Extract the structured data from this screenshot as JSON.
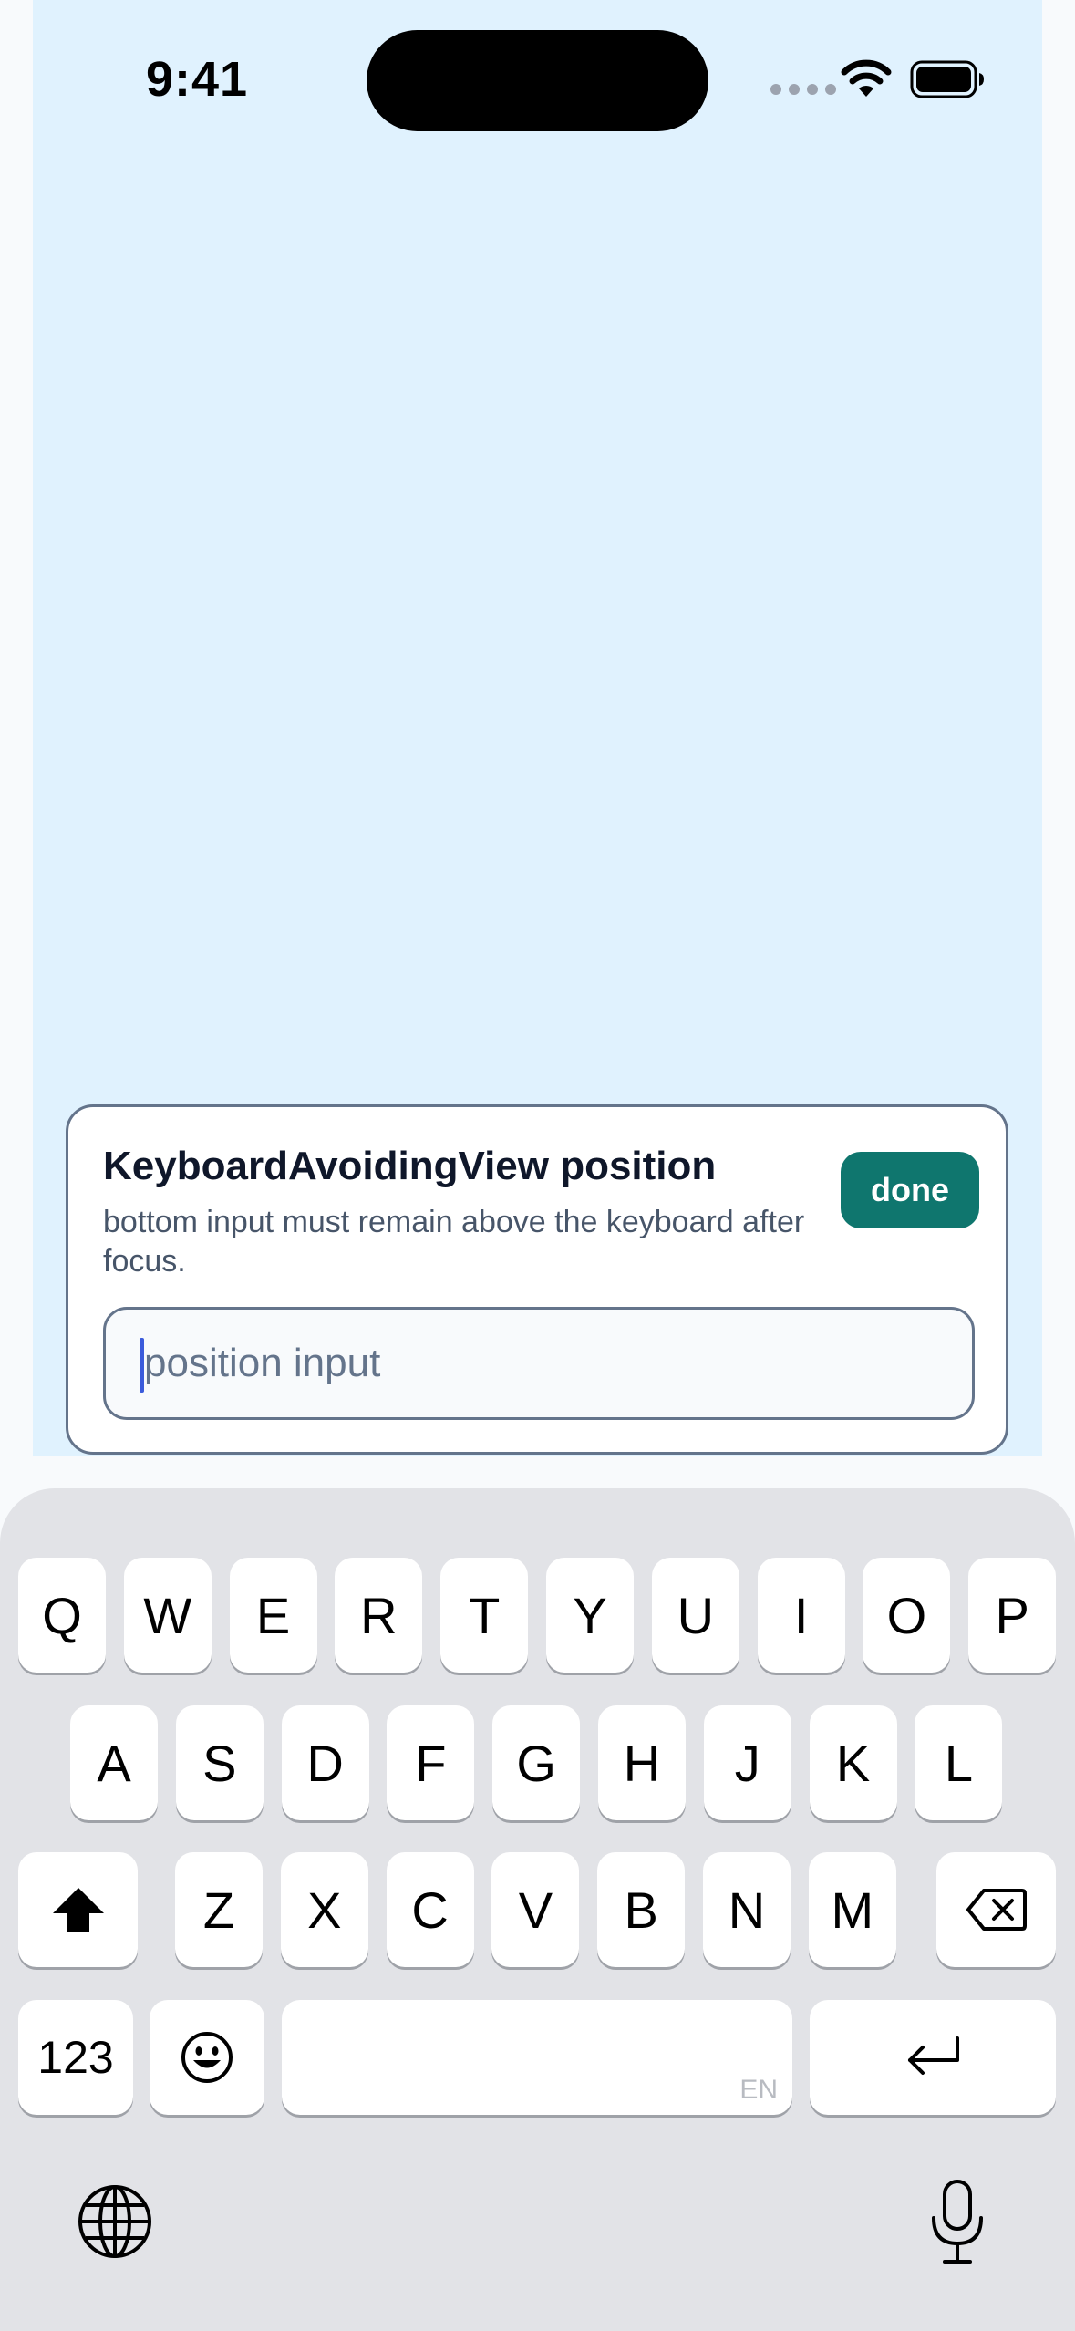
{
  "status_bar": {
    "time": "9:41"
  },
  "card": {
    "title": "KeyboardAvoidingView position",
    "description": "bottom input must remain above the keyboard after focus.",
    "done_label": "done",
    "input_placeholder": "position input"
  },
  "keyboard": {
    "row1": [
      "Q",
      "W",
      "E",
      "R",
      "T",
      "Y",
      "U",
      "I",
      "O",
      "P"
    ],
    "row2": [
      "A",
      "S",
      "D",
      "F",
      "G",
      "H",
      "J",
      "K",
      "L"
    ],
    "row3": [
      "Z",
      "X",
      "C",
      "V",
      "B",
      "N",
      "M"
    ],
    "numbers_label": "123",
    "space_hint": "EN"
  },
  "colors": {
    "app_background": "#e0f2fe",
    "accent": "#0f766e",
    "caret": "#3b5bdb"
  }
}
